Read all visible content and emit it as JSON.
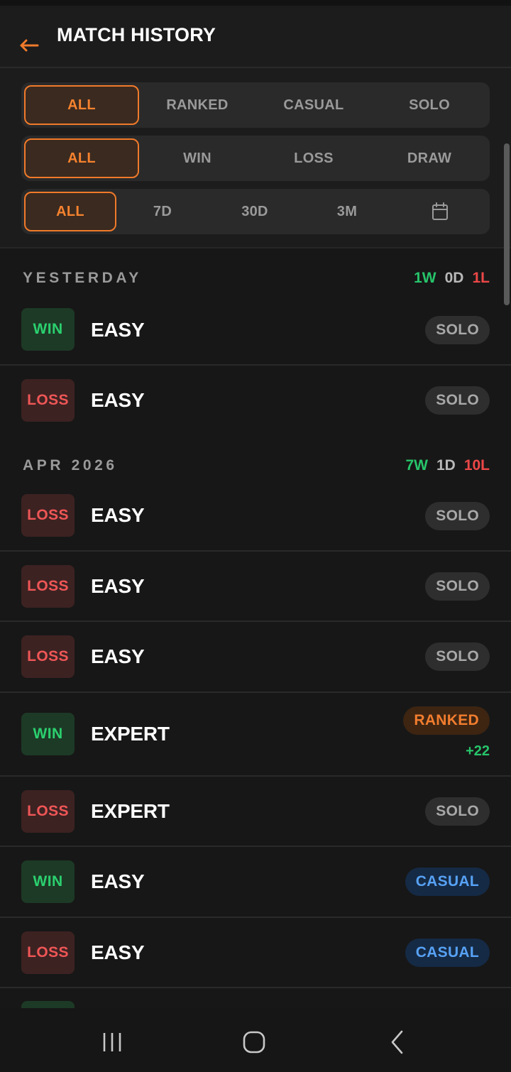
{
  "header": {
    "title": "MATCH HISTORY",
    "back_icon": "arrow-left-icon"
  },
  "colors": {
    "accent": "#f5822f",
    "win": "#27c46a",
    "loss": "#ec4747",
    "casual": "#57a2f5"
  },
  "filters": {
    "mode": {
      "options": [
        "ALL",
        "RANKED",
        "CASUAL",
        "SOLO"
      ],
      "selected": "ALL"
    },
    "result": {
      "options": [
        "ALL",
        "WIN",
        "LOSS",
        "DRAW"
      ],
      "selected": "ALL"
    },
    "period": {
      "options": [
        "ALL",
        "7D",
        "30D",
        "3M"
      ],
      "selected": "ALL",
      "calendar_icon": "calendar-icon"
    }
  },
  "groups": [
    {
      "title": "YESTERDAY",
      "stats": {
        "w": "1W",
        "d": "0D",
        "l": "1L"
      },
      "matches": [
        {
          "result": "WIN",
          "difficulty": "EASY",
          "mode": "SOLO"
        },
        {
          "result": "LOSS",
          "difficulty": "EASY",
          "mode": "SOLO"
        }
      ]
    },
    {
      "title": "APR 2026",
      "stats": {
        "w": "7W",
        "d": "1D",
        "l": "10L"
      },
      "matches": [
        {
          "result": "LOSS",
          "difficulty": "EASY",
          "mode": "SOLO"
        },
        {
          "result": "LOSS",
          "difficulty": "EASY",
          "mode": "SOLO"
        },
        {
          "result": "LOSS",
          "difficulty": "EASY",
          "mode": "SOLO"
        },
        {
          "result": "WIN",
          "difficulty": "EXPERT",
          "mode": "RANKED",
          "delta": "+22"
        },
        {
          "result": "LOSS",
          "difficulty": "EXPERT",
          "mode": "SOLO"
        },
        {
          "result": "WIN",
          "difficulty": "EASY",
          "mode": "CASUAL"
        },
        {
          "result": "LOSS",
          "difficulty": "EASY",
          "mode": "CASUAL"
        }
      ]
    }
  ],
  "navbar": {
    "recents_icon": "recents-icon",
    "home_icon": "home-icon",
    "back_icon": "back-chevron-icon"
  }
}
